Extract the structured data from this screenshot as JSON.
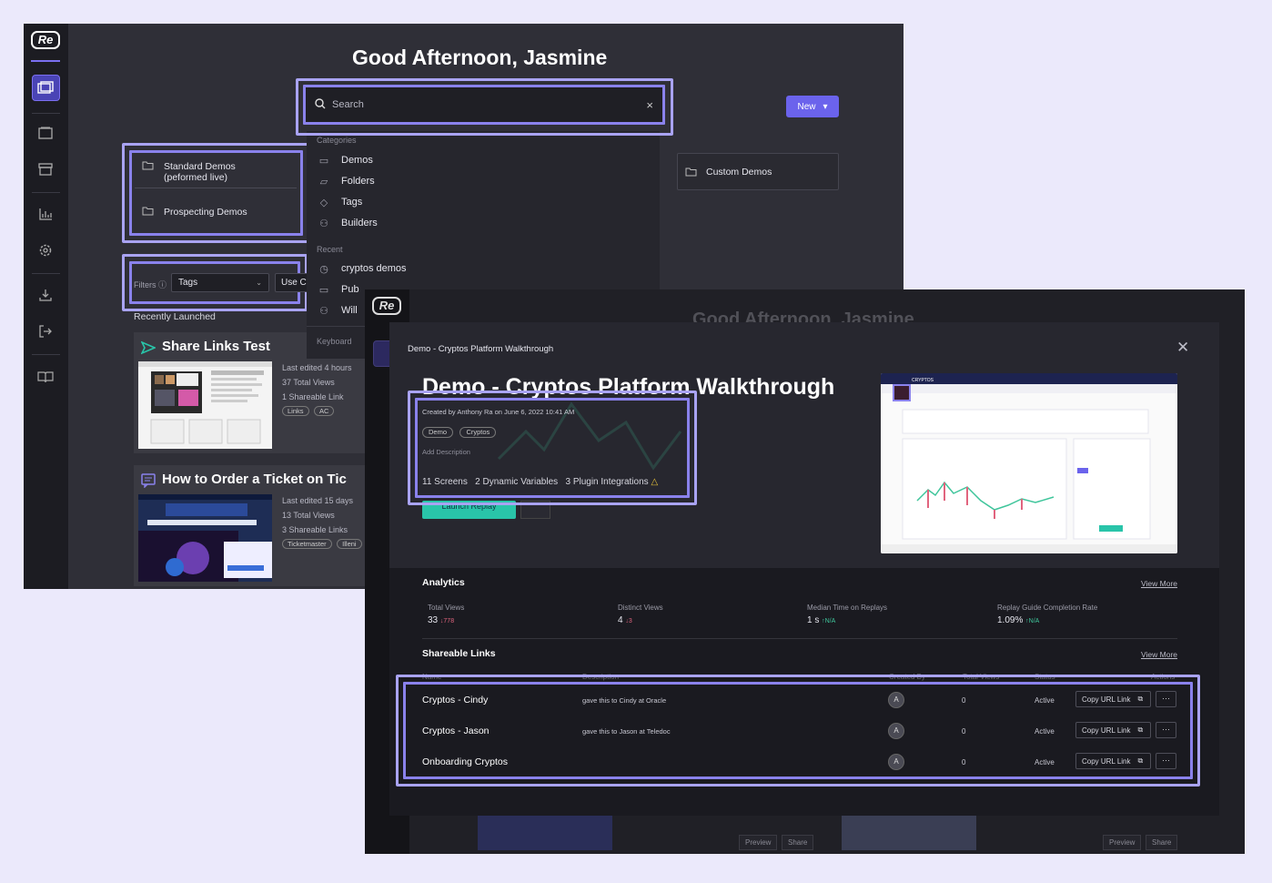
{
  "app": {
    "logo": "Re"
  },
  "window1": {
    "greeting": "Good Afternoon, Jasmine",
    "search": {
      "placeholder": "Search",
      "clear": "×"
    },
    "dropdown": {
      "categories_label": "Categories",
      "categories": [
        "Demos",
        "Folders",
        "Tags",
        "Builders"
      ],
      "recent_label": "Recent",
      "recent": [
        "cryptos demos",
        "Pub",
        "Will"
      ],
      "keyboard_label": "Keyboard"
    },
    "new_button": "New",
    "folders": [
      "Standard Demos\n(peformed live)",
      "Prospecting Demos"
    ],
    "custom_folder": "Custom Demos",
    "filters": {
      "label": "Filters",
      "tags": "Tags",
      "use": "Use C"
    },
    "recently_launched": "Recently Launched",
    "cards": [
      {
        "title": "Share Links Test",
        "meta": [
          "Last edited 4 hours",
          "37 Total Views",
          "1 Shareable Link"
        ],
        "chips": [
          "Links",
          "AC"
        ]
      },
      {
        "title": "How to Order a Ticket on Tic",
        "meta": [
          "Last edited 15 days",
          "13 Total Views",
          "3 Shareable Links"
        ],
        "chips": [
          "Ticketmaster",
          "Illeni"
        ]
      }
    ]
  },
  "window2": {
    "ghost_greeting": "Good Afternoon, Jasmine",
    "modal": {
      "breadcrumb": "Demo - Cryptos Platform Walkthrough",
      "title": "Demo - Cryptos Platform Walkthrough",
      "created": "Created by Anthony Ra on June 6, 2022 10:41 AM",
      "chips": [
        "Demo",
        "Cryptos"
      ],
      "add_description": "Add Description",
      "stats": "11 Screens   2 Dynamic Variables   3 Plugin Integrations",
      "launch": "Launch Replay",
      "preview_brand": "CRYPTOS"
    },
    "analytics": {
      "title": "Analytics",
      "view_more": "View More",
      "stats": [
        {
          "label": "Total Views",
          "value": "33",
          "delta": "↓778",
          "dir": "down"
        },
        {
          "label": "Distinct Views",
          "value": "4",
          "delta": "↓3",
          "dir": "down"
        },
        {
          "label": "Median Time on Replays",
          "value": "1 s",
          "delta": "↑N/A",
          "dir": "up"
        },
        {
          "label": "Replay Guide Completion Rate",
          "value": "1.09%",
          "delta": "↑N/A",
          "dir": "up"
        }
      ]
    },
    "links": {
      "title": "Shareable Links",
      "view_more": "View More",
      "headers": [
        "Name",
        "Description",
        "Created By",
        "Total Views",
        "Status",
        "Actions"
      ],
      "rows": [
        {
          "name": "Cryptos - Cindy",
          "desc": "gave this to Cindy at Oracle",
          "avatar": "A",
          "views": "0",
          "status": "Active",
          "copy": "Copy URL Link"
        },
        {
          "name": "Cryptos - Jason",
          "desc": "gave this to Jason at Teledoc",
          "avatar": "A",
          "views": "0",
          "status": "Active",
          "copy": "Copy URL Link"
        },
        {
          "name": "Onboarding Cryptos",
          "desc": "",
          "avatar": "A",
          "views": "0",
          "status": "Active",
          "copy": "Copy URL Link"
        }
      ],
      "more": "···"
    },
    "bottom_buttons": [
      "Preview",
      "Share",
      "Preview",
      "Share"
    ]
  }
}
